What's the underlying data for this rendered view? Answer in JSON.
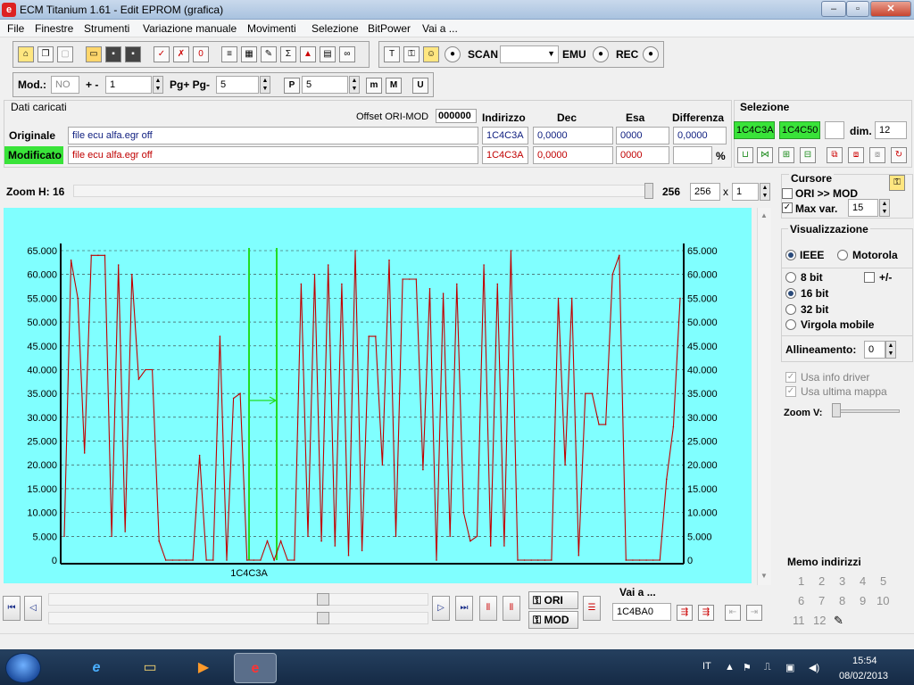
{
  "window": {
    "title": "ECM Titanium 1.61 - Edit EPROM (grafica)",
    "app_icon": "e",
    "minimize": "–",
    "restore": "▫",
    "close": "✕"
  },
  "menu": [
    "File",
    "Finestre",
    "Strumenti",
    "Variazione manuale",
    "Movimenti",
    "Selezione",
    "BitPower",
    "Vai a ..."
  ],
  "toolbar1": {
    "scan_label": "SCAN",
    "scan_value": "",
    "emu_label": "EMU",
    "rec_label": "REC"
  },
  "toolbar2": {
    "mod_label": "Mod.:",
    "mod_value": "NO",
    "plusminus_label": "+ -",
    "plusminus_value": "1",
    "pg_label": "Pg+ Pg-",
    "pg_value": "5",
    "p_value": "5",
    "p_icon_label": "P",
    "m_icon_label": "m",
    "M_icon_label": "M",
    "U_icon_label": "U"
  },
  "dati": {
    "title": "Dati caricati",
    "offset_label": "Offset ORI-MOD",
    "offset_value": "000000",
    "headers": {
      "indirizzo": "Indirizzo",
      "dec": "Dec",
      "esa": "Esa",
      "differenza": "Differenza"
    },
    "originale": {
      "label": "Originale",
      "file": "file ecu alfa.egr off",
      "indirizzo": "1C4C3A",
      "dec": "0,0000",
      "esa": "0000",
      "differenza": "0,0000"
    },
    "modificato": {
      "label": "Modificato",
      "file": "file ecu alfa.egr off",
      "indirizzo": "1C4C3A",
      "dec": "0,0000",
      "esa": "0000",
      "differenza": "",
      "percent": "%"
    }
  },
  "selezione": {
    "title": "Selezione",
    "start": "1C4C3A",
    "end": "1C4C50",
    "extra": "",
    "dim_label": "dim.",
    "dim_value": "12"
  },
  "zoom": {
    "label": "Zoom H: 16",
    "value_text": "256",
    "value_field": "256",
    "x_label": "x",
    "multiplier": "1"
  },
  "cursore": {
    "title": "Cursore",
    "ori_mod_label": "ORI >> MOD",
    "ori_mod_checked": false,
    "maxvar_label": "Max var.",
    "maxvar_checked": true,
    "maxvar_value": "15"
  },
  "visualizzazione": {
    "title": "Visualizzazione",
    "ieee": "IEEE",
    "motorola": "Motorola",
    "bit8": "8 bit",
    "pm": "+/-",
    "bit16": "16 bit",
    "bit32": "32 bit",
    "float": "Virgola mobile",
    "allineamento_label": "Allineamento:",
    "allineamento_value": "0",
    "usa_info": "Usa info driver",
    "usa_ultima": "Usa ultima mappa",
    "zoomv_label": "Zoom V:"
  },
  "memo": {
    "title": "Memo indirizzi",
    "slots": [
      "1",
      "2",
      "3",
      "4",
      "5",
      "6",
      "7",
      "8",
      "9",
      "10",
      "11",
      "12"
    ]
  },
  "nav": {
    "ori_label": "ORI",
    "mod_label": "MOD",
    "vai_label": "Vai a ...",
    "vai_value": "1C4BA0",
    "scroll_pos_1": 0.73,
    "scroll_pos_2": 0.73
  },
  "taskbar": {
    "lang": "IT",
    "time": "15:54",
    "date": "08/02/2013"
  },
  "chart_data": {
    "type": "line",
    "x_label_under_axis": "1C4C3A",
    "ylim": [
      0,
      65000
    ],
    "y_ticks": [
      "0",
      "5.000",
      "10.000",
      "15.000",
      "20.000",
      "25.000",
      "30.000",
      "35.000",
      "40.000",
      "45.000",
      "50.000",
      "55.000",
      "60.000",
      "65.000"
    ],
    "grid": true,
    "background": "#80ffff",
    "line_color": "#c00000",
    "cursor_color": "#22dd22",
    "series": [
      {
        "values": [
          5000,
          63000,
          55000,
          22500,
          64000,
          64000,
          64000,
          5000,
          62000,
          6000,
          60000,
          38000,
          40000,
          40000,
          4000,
          0,
          0,
          0,
          0,
          0,
          22000,
          0,
          0,
          47000,
          0,
          34000,
          35000,
          0,
          0,
          0,
          4000,
          0,
          4000,
          0,
          0,
          58000,
          5000,
          60000,
          4000,
          62000,
          3000,
          58000,
          1000,
          65000,
          2000,
          47000,
          47000,
          20000,
          63000,
          5000,
          59000,
          59000,
          59000,
          19000,
          57000,
          0,
          56000,
          5000,
          58000,
          10000,
          4000,
          5000,
          62000,
          3000,
          58000,
          3000,
          65000,
          0,
          0,
          0,
          0,
          0,
          0,
          55000,
          20000,
          55000,
          1000,
          35000,
          35000,
          28500,
          28500,
          60000,
          64000,
          0,
          0,
          0,
          0,
          0,
          0,
          17000,
          28000,
          55000
        ]
      }
    ]
  }
}
